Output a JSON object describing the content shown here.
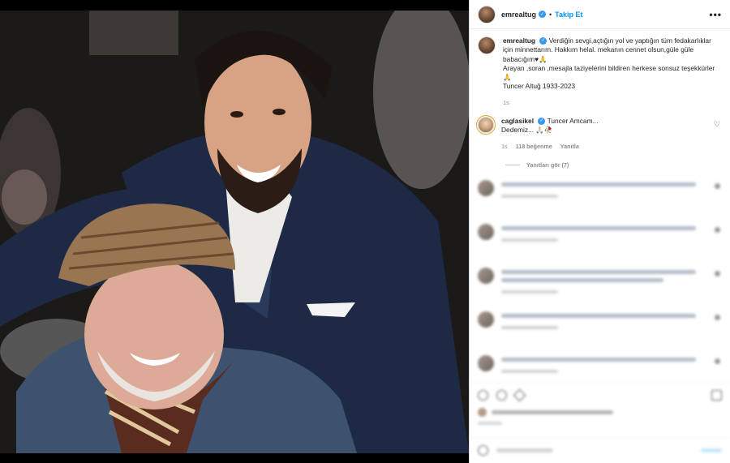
{
  "header": {
    "username": "emrealtug",
    "separator": "•",
    "follow_label": "Takip Et",
    "more_label": "•••"
  },
  "caption": {
    "username": "emrealtug",
    "text_line1": "Verdiğin sevgi,açtığın yol ve yaptığın tüm fedakarlıklar için minnettarım. Hakkım helal. mekanın cennet olsun,güle güle babacığım♥🙏",
    "text_line2": "Arayan ,soran ,mesajla taziyelerini bildiren herkese sonsuz teşekkürler🙏",
    "text_line3": "Tuncer Altuğ 1933-2023",
    "time": "1s"
  },
  "comment": {
    "username": "caglasikel",
    "text_line1": "Tuncer Amcam...",
    "text_line2": "Dedemiz... 🙏🏻🥀",
    "time": "1s",
    "likes": "118 beğenme",
    "reply": "Yanıtla",
    "view_replies": "Yanıtları gör (7)"
  },
  "colors": {
    "accent": "#0095f6",
    "verified": "#3897f0"
  }
}
